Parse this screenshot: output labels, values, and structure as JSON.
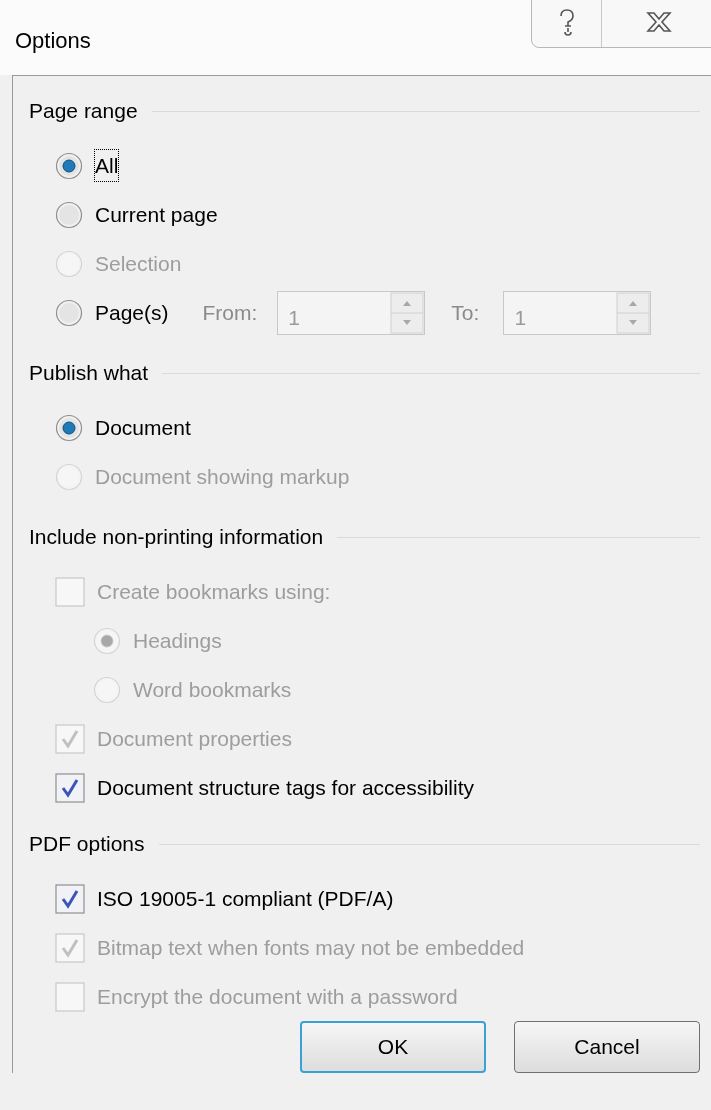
{
  "window": {
    "title": "Options"
  },
  "sections": [
    {
      "title": "Page range",
      "items": [
        {
          "kind": "radio",
          "label": "All",
          "selected": true,
          "disabled": false,
          "focused": true
        },
        {
          "kind": "radio",
          "label": "Current page",
          "selected": false,
          "disabled": false,
          "focused": false
        },
        {
          "kind": "radio",
          "label": "Selection",
          "selected": false,
          "disabled": true,
          "focused": false
        },
        {
          "kind": "page_range",
          "label": "Page(s)",
          "selected": false,
          "disabled": false,
          "focused": false,
          "from": {
            "label": "From:",
            "value": "1",
            "disabled": true
          },
          "to": {
            "label": "To:",
            "value": "1",
            "disabled": true
          }
        }
      ]
    },
    {
      "title": "Publish what",
      "items": [
        {
          "kind": "radio",
          "label": "Document",
          "selected": true,
          "disabled": false,
          "focused": false
        },
        {
          "kind": "radio",
          "label": "Document showing markup",
          "selected": false,
          "disabled": true,
          "focused": false
        }
      ]
    },
    {
      "title": "Include non-printing information",
      "items": [
        {
          "kind": "checkbox",
          "label": "Create bookmarks using:",
          "checked": false,
          "disabled": true,
          "children": [
            {
              "kind": "radio",
              "label": "Headings",
              "selected": true,
              "disabled": true,
              "focused": false
            },
            {
              "kind": "radio",
              "label": "Word bookmarks",
              "selected": false,
              "disabled": true,
              "focused": false
            }
          ]
        },
        {
          "kind": "checkbox",
          "label": "Document properties",
          "checked": true,
          "disabled": true
        },
        {
          "kind": "checkbox",
          "label": "Document structure tags for accessibility",
          "checked": true,
          "disabled": false
        }
      ]
    },
    {
      "title": "PDF options",
      "items": [
        {
          "kind": "checkbox",
          "label": "ISO 19005-1 compliant (PDF/A)",
          "checked": true,
          "disabled": false
        },
        {
          "kind": "checkbox",
          "label": "Bitmap text when fonts may not be embedded",
          "checked": true,
          "disabled": true
        },
        {
          "kind": "checkbox",
          "label": "Encrypt the document with a password",
          "checked": false,
          "disabled": true
        }
      ]
    }
  ],
  "buttons": [
    {
      "label": "OK",
      "default": true
    },
    {
      "label": "Cancel",
      "default": false
    }
  ]
}
